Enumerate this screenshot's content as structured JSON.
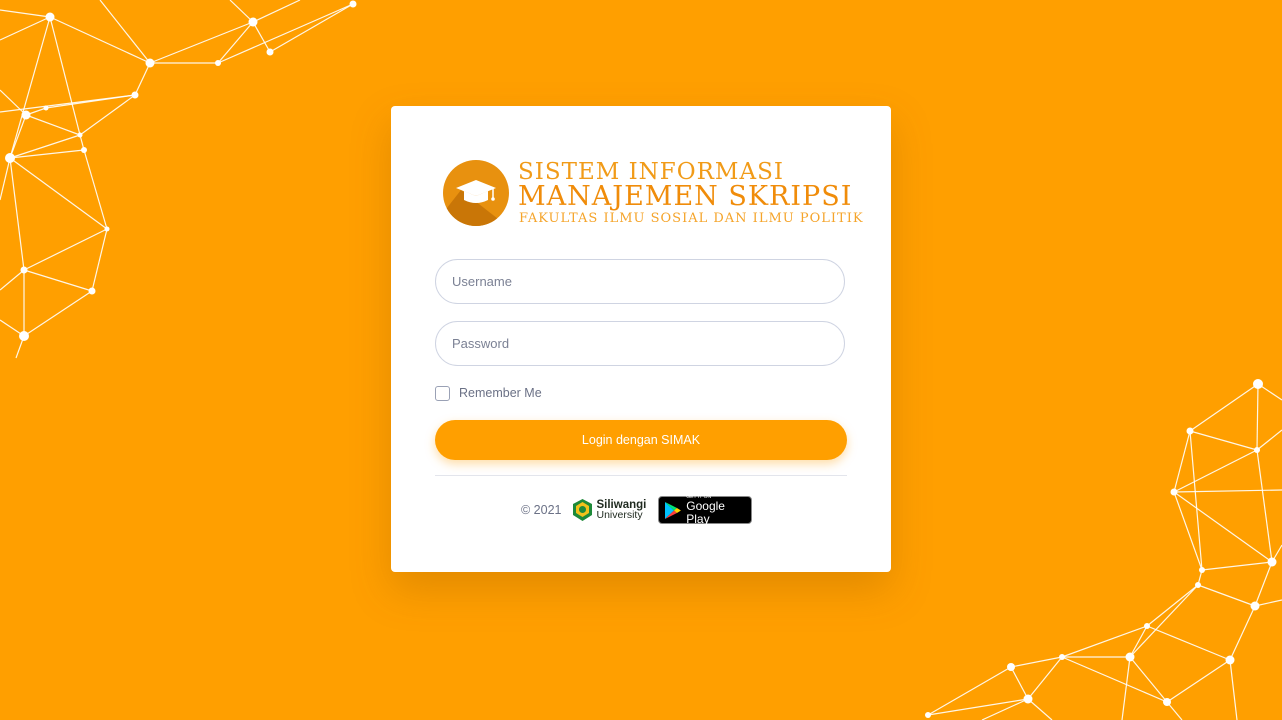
{
  "brand": {
    "line1": "SISTEM INFORMASI",
    "line2": "MANAJEMEN SKRIPSI",
    "line3": "FAKULTAS ILMU SOSIAL DAN ILMU POLITIK",
    "logo_icon": "graduation-cap-icon"
  },
  "form": {
    "username_placeholder": "Username",
    "password_placeholder": "Password",
    "remember_label": "Remember Me",
    "login_label": "Login dengan SIMAK"
  },
  "footer": {
    "copyright": "© 2021",
    "university_name_line1": "Siliwangi",
    "university_name_line2": "University",
    "store_badge_small": "GET IT ON",
    "store_badge_big": "Google Play"
  },
  "colors": {
    "background": "#ff9f00",
    "accent": "#ff9f00",
    "brand_text": "#f08c0a",
    "card": "#ffffff"
  }
}
